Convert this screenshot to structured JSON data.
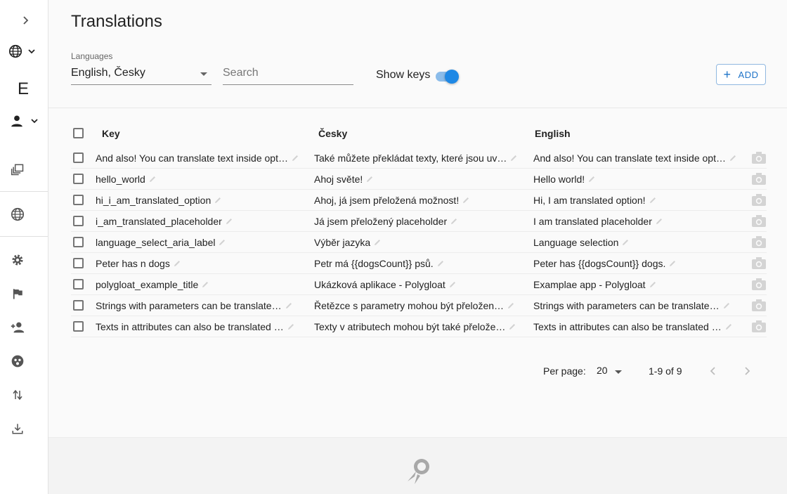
{
  "sidebar": {
    "expand_icon": "chevron-right-icon",
    "language_icon": "globe-icon",
    "project_letter": "E",
    "user_icon": "person-icon",
    "items": [
      {
        "name": "projects",
        "icon": "copy-icon"
      },
      {
        "name": "languages",
        "icon": "globe-icon"
      },
      {
        "name": "settings",
        "icon": "gear-icon"
      },
      {
        "name": "flags",
        "icon": "flag-icon"
      },
      {
        "name": "permissions",
        "icon": "person-add-icon"
      },
      {
        "name": "integrations",
        "icon": "emoji-icon"
      },
      {
        "name": "import-export",
        "icon": "swap-vert-icon"
      },
      {
        "name": "download",
        "icon": "download-icon"
      }
    ]
  },
  "header": {
    "title": "Translations",
    "languages_label": "Languages",
    "languages_value": "English, Česky",
    "search_placeholder": "Search",
    "show_keys_label": "Show keys",
    "show_keys_on": true,
    "add_label": "ADD"
  },
  "table": {
    "columns": [
      "Key",
      "Česky",
      "English"
    ],
    "rows": [
      {
        "key": "And also! You can translate text inside opt…",
        "cs": "Také můžete překládat texty, které jsou uv…",
        "en": "And also! You can translate text inside opt…"
      },
      {
        "key": "hello_world",
        "cs": "Ahoj světe!",
        "en": "Hello world!"
      },
      {
        "key": "hi_i_am_translated_option",
        "cs": "Ahoj, já jsem přeložená možnost!",
        "en": "Hi, I am translated option!"
      },
      {
        "key": "i_am_translated_placeholder",
        "cs": "Já jsem přeložený placeholder",
        "en": "I am translated placeholder"
      },
      {
        "key": "language_select_aria_label",
        "cs": "Výběr jazyka",
        "en": "Language selection"
      },
      {
        "key": "Peter has n dogs",
        "cs": "Petr má {{dogsCount}} psů.",
        "en": "Peter has {{dogsCount}} dogs."
      },
      {
        "key": "polygloat_example_title",
        "cs": "Ukázková aplikace - Polygloat",
        "en": "Examplae app - Polygloat"
      },
      {
        "key": "Strings with parameters can be translate…",
        "cs": "Řetězce s parametry mohou být přeložen…",
        "en": "Strings with parameters can be translate…"
      },
      {
        "key": "Texts in attributes can also be translated …",
        "cs": "Texty v atributech mohou být také přelože…",
        "en": "Texts in attributes can also be translated …"
      }
    ]
  },
  "pagination": {
    "per_page_label": "Per page:",
    "per_page_value": "20",
    "range": "1-9 of 9"
  },
  "colors": {
    "accent": "#1e88e5",
    "background": "#fafafa"
  }
}
